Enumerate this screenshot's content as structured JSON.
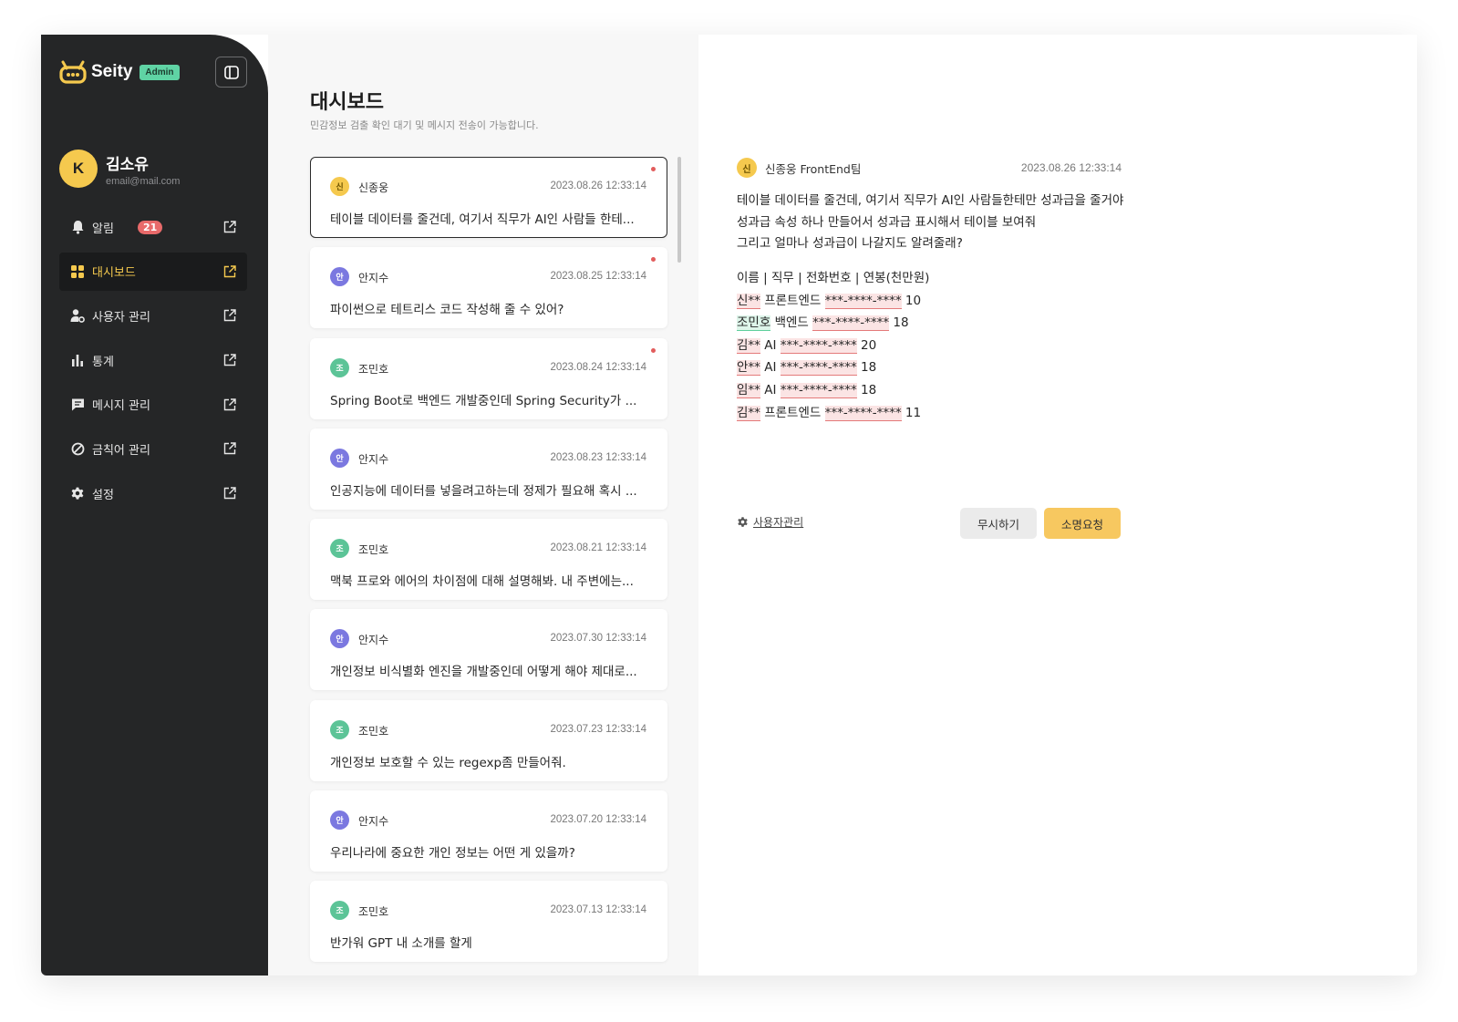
{
  "app": {
    "name": "Seity",
    "role_badge": "Admin"
  },
  "user": {
    "initial": "K",
    "name": "김소유",
    "email": "email@mail.com"
  },
  "nav": [
    {
      "label": "알림",
      "icon": "bell-icon",
      "badge": "21",
      "active": false
    },
    {
      "label": "대시보드",
      "icon": "grid-icon",
      "active": true
    },
    {
      "label": "사용자 관리",
      "icon": "user-gear-icon",
      "active": false
    },
    {
      "label": "통계",
      "icon": "bar-chart-icon",
      "active": false
    },
    {
      "label": "메시지 관리",
      "icon": "message-icon",
      "active": false
    },
    {
      "label": "금칙어 관리",
      "icon": "ban-icon",
      "active": false
    },
    {
      "label": "설정",
      "icon": "gear-icon",
      "active": false
    }
  ],
  "page": {
    "title": "대시보드",
    "subtitle": "민감정보 검출 확인 대기 및 메시지 전송이 가능합니다."
  },
  "messages": [
    {
      "avatar": "신",
      "avatar_color": "#f5c94e",
      "avatar_text_color": "#6b5200",
      "name": "신종웅",
      "time": "2023.08.26 12:33:14",
      "text": "테이블 데이터를 줄건데, 여기서 직무가 AI인 사람들 한테...",
      "unread": true,
      "selected": true
    },
    {
      "avatar": "안",
      "avatar_color": "#7b78e0",
      "avatar_text_color": "#ffffff",
      "name": "안지수",
      "time": "2023.08.25 12:33:14",
      "text": "파이썬으로 테트리스 코드 작성해 줄 수 있어?",
      "unread": true,
      "selected": false
    },
    {
      "avatar": "조",
      "avatar_color": "#5cc497",
      "avatar_text_color": "#ffffff",
      "name": "조민호",
      "time": "2023.08.24 12:33:14",
      "text": "Spring Boot로 백엔드 개발중인데 Spring Security가 ...",
      "unread": true,
      "selected": false
    },
    {
      "avatar": "안",
      "avatar_color": "#7b78e0",
      "avatar_text_color": "#ffffff",
      "name": "안지수",
      "time": "2023.08.23 12:33:14",
      "text": "인공지능에 데이터를 넣을려고하는데 정제가 필요해 혹시 ...",
      "unread": false,
      "selected": false
    },
    {
      "avatar": "조",
      "avatar_color": "#5cc497",
      "avatar_text_color": "#ffffff",
      "name": "조민호",
      "time": "2023.08.21 12:33:14",
      "text": "맥북 프로와 에어의 차이점에 대해 설명해봐. 내 주변에는...",
      "unread": false,
      "selected": false
    },
    {
      "avatar": "안",
      "avatar_color": "#7b78e0",
      "avatar_text_color": "#ffffff",
      "name": "안지수",
      "time": "2023.07.30 12:33:14",
      "text": "개인정보 비식별화 엔진을 개발중인데 어떻게 해야 제대로...",
      "unread": false,
      "selected": false
    },
    {
      "avatar": "조",
      "avatar_color": "#5cc497",
      "avatar_text_color": "#ffffff",
      "name": "조민호",
      "time": "2023.07.23 12:33:14",
      "text": "개인정보 보호할 수 있는 regexp좀 만들어줘.",
      "unread": false,
      "selected": false
    },
    {
      "avatar": "안",
      "avatar_color": "#7b78e0",
      "avatar_text_color": "#ffffff",
      "name": "안지수",
      "time": "2023.07.20 12:33:14",
      "text": "우리나라에 중요한 개인 정보는 어떤 게 있을까?",
      "unread": false,
      "selected": false
    },
    {
      "avatar": "조",
      "avatar_color": "#5cc497",
      "avatar_text_color": "#ffffff",
      "name": "조민호",
      "time": "2023.07.13 12:33:14",
      "text": "반가워 GPT 내 소개를 할게",
      "unread": false,
      "selected": false
    }
  ],
  "detail": {
    "avatar": "신",
    "sender": "신종웅 FrontEnd팀",
    "time": "2023.08.26 12:33:14",
    "message_lines": [
      "테이블 데이터를 줄건데, 여기서 직무가 AI인 사람들한테만 성과급을 줄거야",
      "성과급 속성 하나 만들어서 성과급 표시해서 테이블 보여줘",
      "그리고 얼마나 성과급이 나갈지도 알려줄래?"
    ],
    "table_header": "이름 | 직무 | 전화번호 | 연봉(천만원)",
    "table_rows": [
      {
        "name": "신**",
        "name_hl": "red",
        "job": "프론트엔드",
        "phone": "***-****-****",
        "salary": "10"
      },
      {
        "name": "조민호",
        "name_hl": "green",
        "job": "백엔드",
        "phone": "***-****-****",
        "salary": "18"
      },
      {
        "name": "김**",
        "name_hl": "red",
        "job": "AI",
        "phone": "***-****-****",
        "salary": "20"
      },
      {
        "name": "안**",
        "name_hl": "red",
        "job": "AI",
        "phone": "***-****-****",
        "salary": "18"
      },
      {
        "name": "임**",
        "name_hl": "red",
        "job": "AI",
        "phone": "***-****-****",
        "salary": "18"
      },
      {
        "name": "김**",
        "name_hl": "red",
        "job": "프론트엔드",
        "phone": "***-****-****",
        "salary": "11"
      }
    ],
    "user_mgmt_link": "사용자관리",
    "ignore_button": "무시하기",
    "request_button": "소명요청"
  },
  "colors": {
    "sidebar_bg": "#252627",
    "accent": "#f5c94e",
    "badge_red": "#e86a6a",
    "pii_red": "#e47a7a",
    "pii_green": "#5fcf9c"
  }
}
